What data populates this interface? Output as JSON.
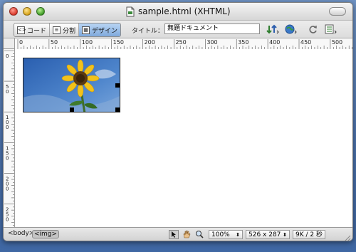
{
  "window": {
    "title": "sample.html (XHTML)"
  },
  "toolbar": {
    "view_buttons": [
      {
        "label": "コード",
        "icon": "code-view-icon",
        "active": false
      },
      {
        "label": "分割",
        "icon": "split-view-icon",
        "active": false
      },
      {
        "label": "デザイン",
        "icon": "design-view-icon",
        "active": true
      }
    ],
    "title_label": "タイトル：",
    "title_value": "無題ドキュメント",
    "icons": [
      "file-management-icon",
      "preview-browser-icon",
      "refresh-icon",
      "view-options-icon"
    ]
  },
  "ruler": {
    "h_labels": [
      "0",
      "50",
      "100",
      "150",
      "200",
      "250",
      "300",
      "350",
      "400",
      "450",
      "500"
    ],
    "v_labels": [
      "0",
      "50",
      "100",
      "150",
      "200",
      "250"
    ]
  },
  "document": {
    "image": "sunflower-image"
  },
  "statusbar": {
    "tags": [
      "<body>",
      "<img>"
    ],
    "zoom": "100%",
    "dimensions": "526 x 287",
    "size": "9K / 2 秒"
  },
  "colors": {
    "desktop": "#5b80b8",
    "active_view": "#8fb4e2"
  }
}
